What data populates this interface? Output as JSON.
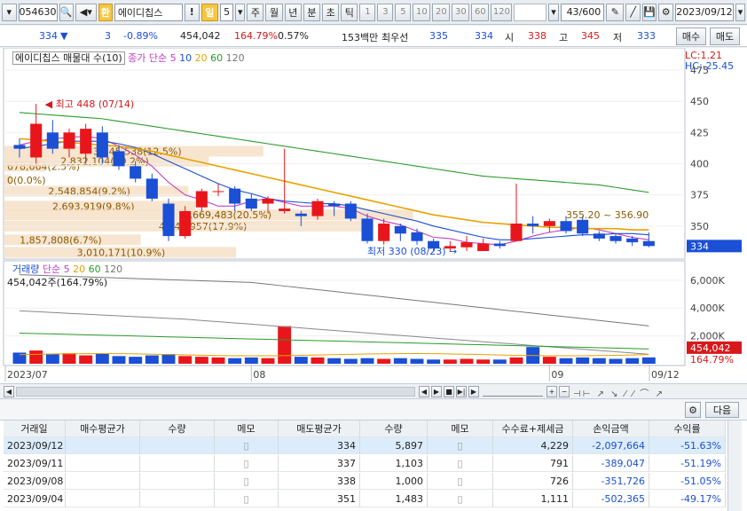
{
  "toolbar": {
    "code": "054630",
    "name_badge": "환",
    "stock_name": "에이디칩스",
    "exclaim": "!",
    "period_selected": "일",
    "period_value": "5",
    "period_tabs": [
      "주",
      "월",
      "년",
      "분",
      "초",
      "틱"
    ],
    "number_buttons": [
      "1",
      "3",
      "5",
      "10",
      "20",
      "30",
      "60",
      "120"
    ],
    "count": "43",
    "total": "/600",
    "date": "2023/09/12"
  },
  "quote": {
    "price": "334",
    "change_arrow": "▼",
    "change": "3",
    "change_pct": "-0.89%",
    "volume": "454,042",
    "volume_ratio": "164.79%",
    "turnover": "0.57%",
    "amount": "153백만",
    "best_sell_label": "최우선",
    "best_ask": "335",
    "best_bid": "334",
    "open_label": "시",
    "open": "338",
    "high_label": "고",
    "high": "345",
    "low_label": "저",
    "low": "333",
    "buy_button": "매수",
    "sell_button": "매도"
  },
  "price_pane": {
    "title": "에이디칩스 매물대 수(10)",
    "ma_label": "종가 단순",
    "ma_periods": [
      "5",
      "10",
      "20",
      "60",
      "120"
    ],
    "ma_colors": [
      "#c040c0",
      "#1a4fd6",
      "#e8a200",
      "#2a9a2a",
      "#777777"
    ],
    "lc_label": "LC:1.21",
    "hc_label": "HC:-25.45",
    "y_ticks": [
      475,
      450,
      425,
      400,
      375,
      350
    ],
    "current_price_tag": "334",
    "high_annotation": "최고 448 (07/14)",
    "low_annotation": "최저 330 (08/23)",
    "volume_profile": [
      {
        "label": "678,664(2.5%)",
        "price": 398,
        "width": 0.06
      },
      {
        "label": "0(0.0%)",
        "price": 387,
        "width": 0.01
      },
      {
        "label": "2,832,104(10.2%)",
        "price": 402,
        "width": 0.3
      },
      {
        "label": "3,445,538(12.5%)",
        "price": 410,
        "width": 0.38
      },
      {
        "label": "2,548,854(9.2%)",
        "price": 378,
        "width": 0.27
      },
      {
        "label": "2,693,919(9.8%)",
        "price": 366,
        "width": 0.28
      },
      {
        "label": "1,857,808(6.7%)",
        "price": 339,
        "width": 0.2
      },
      {
        "label": "5,669,483(20.5%)",
        "price": 359,
        "width": 0.6
      },
      {
        "label": "4,945,957(17.9%)",
        "price": 350,
        "width": 0.54
      },
      {
        "label": "3,010,171(10.9%)",
        "price": 329,
        "width": 0.34
      }
    ],
    "range_label": "355.20 ~ 356.90"
  },
  "volume_pane": {
    "title": "거래량",
    "ma_label": "단순",
    "ma_periods": [
      "5",
      "20",
      "60",
      "120"
    ],
    "current_label": "454,042주(164.79%)",
    "y_ticks": [
      "6,000K",
      "4,000K",
      "2,000K"
    ],
    "volume_tag": "454,042",
    "ratio_tag": "164.79%"
  },
  "x_axis": {
    "labels": [
      "2023/07",
      "08",
      "09",
      "09/12"
    ]
  },
  "grid": {
    "next_button": "다음",
    "columns": [
      "거래일",
      "매수평균가",
      "수량",
      "메모",
      "매도평균가",
      "수량",
      "메모",
      "수수료+제세금",
      "손익금액",
      "수익률"
    ],
    "rows": [
      {
        "date": "2023/09/12",
        "buy_avg": "",
        "buy_qty": "",
        "sell_avg": "334",
        "sell_qty": "5,897",
        "fee": "4,229",
        "pnl": "-2,097,664",
        "ret": "-51.63%"
      },
      {
        "date": "2023/09/11",
        "buy_avg": "",
        "buy_qty": "",
        "sell_avg": "337",
        "sell_qty": "1,103",
        "fee": "791",
        "pnl": "-389,047",
        "ret": "-51.19%"
      },
      {
        "date": "2023/09/08",
        "buy_avg": "",
        "buy_qty": "",
        "sell_avg": "338",
        "sell_qty": "1,000",
        "fee": "726",
        "pnl": "-351,726",
        "ret": "-51.05%"
      },
      {
        "date": "2023/09/04",
        "buy_avg": "",
        "buy_qty": "",
        "sell_avg": "351",
        "sell_qty": "1,483",
        "fee": "1,111",
        "pnl": "-502,365",
        "ret": "-49.17%"
      }
    ]
  },
  "chart_data": {
    "type": "candlestick",
    "candles": [
      {
        "o": 415,
        "h": 420,
        "l": 405,
        "c": 412
      },
      {
        "o": 405,
        "h": 448,
        "l": 400,
        "c": 432
      },
      {
        "o": 425,
        "h": 435,
        "l": 408,
        "c": 412
      },
      {
        "o": 412,
        "h": 428,
        "l": 405,
        "c": 425
      },
      {
        "o": 408,
        "h": 432,
        "l": 400,
        "c": 428
      },
      {
        "o": 425,
        "h": 430,
        "l": 400,
        "c": 405
      },
      {
        "o": 410,
        "h": 415,
        "l": 395,
        "c": 398
      },
      {
        "o": 398,
        "h": 402,
        "l": 385,
        "c": 388
      },
      {
        "o": 388,
        "h": 392,
        "l": 370,
        "c": 372
      },
      {
        "o": 368,
        "h": 372,
        "l": 338,
        "c": 342
      },
      {
        "o": 342,
        "h": 366,
        "l": 340,
        "c": 362
      },
      {
        "o": 365,
        "h": 380,
        "l": 362,
        "c": 378
      },
      {
        "o": 378,
        "h": 384,
        "l": 374,
        "c": 378
      },
      {
        "o": 380,
        "h": 382,
        "l": 362,
        "c": 368
      },
      {
        "o": 372,
        "h": 376,
        "l": 362,
        "c": 364
      },
      {
        "o": 368,
        "h": 374,
        "l": 360,
        "c": 372
      },
      {
        "o": 362,
        "h": 412,
        "l": 360,
        "c": 364
      },
      {
        "o": 360,
        "h": 362,
        "l": 350,
        "c": 358
      },
      {
        "o": 358,
        "h": 372,
        "l": 355,
        "c": 370
      },
      {
        "o": 368,
        "h": 370,
        "l": 358,
        "c": 366
      },
      {
        "o": 368,
        "h": 370,
        "l": 354,
        "c": 356
      },
      {
        "o": 356,
        "h": 360,
        "l": 336,
        "c": 338
      },
      {
        "o": 338,
        "h": 356,
        "l": 335,
        "c": 352
      },
      {
        "o": 350,
        "h": 352,
        "l": 338,
        "c": 344
      },
      {
        "o": 345,
        "h": 348,
        "l": 335,
        "c": 338
      },
      {
        "o": 338,
        "h": 340,
        "l": 330,
        "c": 332
      },
      {
        "o": 332,
        "h": 338,
        "l": 330,
        "c": 334
      },
      {
        "o": 333,
        "h": 342,
        "l": 330,
        "c": 337
      },
      {
        "o": 330,
        "h": 340,
        "l": 330,
        "c": 336
      },
      {
        "o": 336,
        "h": 338,
        "l": 332,
        "c": 334
      },
      {
        "o": 338,
        "h": 384,
        "l": 338,
        "c": 352
      },
      {
        "o": 352,
        "h": 358,
        "l": 344,
        "c": 350
      },
      {
        "o": 350,
        "h": 356,
        "l": 345,
        "c": 354
      },
      {
        "o": 354,
        "h": 358,
        "l": 344,
        "c": 346
      },
      {
        "o": 355,
        "h": 358,
        "l": 342,
        "c": 344
      },
      {
        "o": 344,
        "h": 346,
        "l": 338,
        "c": 340
      },
      {
        "o": 342,
        "h": 344,
        "l": 336,
        "c": 338
      },
      {
        "o": 340,
        "h": 342,
        "l": 334,
        "c": 337
      },
      {
        "o": 338,
        "h": 345,
        "l": 333,
        "c": 334
      }
    ],
    "volumes": [
      800,
      950,
      700,
      750,
      600,
      700,
      550,
      500,
      600,
      700,
      550,
      500,
      450,
      400,
      450,
      400,
      2700,
      500,
      450,
      400,
      350,
      400,
      350,
      400,
      350,
      300,
      300,
      350,
      300,
      300,
      450,
      1200,
      500,
      400,
      450,
      400,
      350,
      400,
      454
    ],
    "ma_lines": [
      {
        "name": "5",
        "values": [
          415,
          418,
          420,
          421,
          422,
          420,
          414,
          407,
          398,
          385,
          375,
          371,
          366,
          366,
          370,
          372,
          369,
          366,
          366,
          366,
          364,
          358,
          354,
          351,
          346,
          341,
          340,
          337,
          336,
          335,
          338,
          342,
          345,
          347,
          349,
          347,
          344,
          341,
          339
        ]
      },
      {
        "name": "10",
        "values": [
          412,
          414,
          416,
          418,
          418,
          418,
          416,
          413,
          408,
          402,
          396,
          390,
          384,
          379,
          376,
          372,
          370,
          369,
          368,
          368,
          366,
          363,
          360,
          357,
          354,
          350,
          347,
          344,
          341,
          339,
          339,
          340,
          341,
          342,
          343,
          343,
          344,
          344,
          343
        ]
      },
      {
        "name": "20",
        "values": [
          420,
          419,
          418,
          417,
          416,
          415,
          414,
          412,
          410,
          407,
          404,
          401,
          398,
          395,
          392,
          389,
          386,
          383,
          380,
          377,
          374,
          371,
          368,
          365,
          362,
          359,
          357,
          355,
          353,
          352,
          351,
          350,
          349,
          349,
          348,
          348,
          348,
          347,
          347
        ]
      },
      {
        "name": "60",
        "values": [
          441,
          440,
          439,
          438,
          437,
          436,
          434,
          432,
          430,
          428,
          426,
          424,
          422,
          420,
          418,
          416,
          414,
          412,
          410,
          408,
          406,
          404,
          402,
          400,
          398,
          396,
          394,
          392,
          390,
          389,
          388,
          387,
          386,
          385,
          384,
          383,
          381,
          379,
          377
        ]
      }
    ],
    "ylim": [
      325,
      480
    ],
    "volume_ylim": [
      0,
      6500
    ]
  }
}
